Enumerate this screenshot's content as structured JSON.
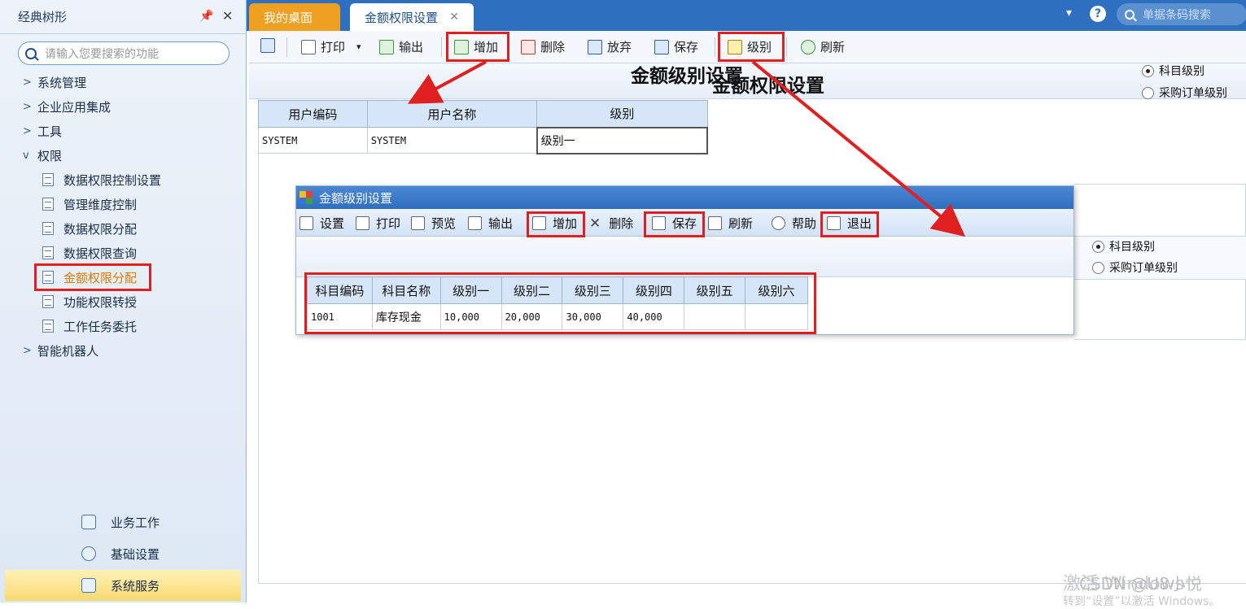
{
  "sidebar": {
    "title": "经典树形",
    "search_placeholder": "请输入您要搜索的功能",
    "tree": [
      {
        "label": "系统管理"
      },
      {
        "label": "企业应用集成"
      },
      {
        "label": "工具"
      },
      {
        "label": "权限"
      }
    ],
    "leaves": [
      {
        "label": "数据权限控制设置"
      },
      {
        "label": "管理维度控制"
      },
      {
        "label": "数据权限分配"
      },
      {
        "label": "数据权限查询"
      },
      {
        "label": "金额权限分配"
      },
      {
        "label": "功能权限转授"
      },
      {
        "label": "工作任务委托"
      }
    ],
    "tree_after": "智能机器人",
    "bottom": [
      {
        "label": "业务工作"
      },
      {
        "label": "基础设置"
      },
      {
        "label": "系统服务"
      }
    ]
  },
  "tabs": [
    {
      "label": "我的桌面"
    },
    {
      "label": "金额权限设置"
    }
  ],
  "top_search_placeholder": "单据条码搜索",
  "toolbar": {
    "print": "打印",
    "export": "输出",
    "add": "增加",
    "delete": "删除",
    "discard": "放弃",
    "save": "保存",
    "level": "级别",
    "refresh": "刷新"
  },
  "page_title": "金额权限设置",
  "radios": {
    "subject": "科目级别",
    "purchase": "采购订单级别"
  },
  "user_table": {
    "headers": [
      "用户编码",
      "用户名称",
      "级别"
    ],
    "rows": [
      [
        "SYSTEM",
        "SYSTEM",
        "级别一"
      ]
    ]
  },
  "dialog": {
    "title": "金额级别设置",
    "toolbar": {
      "settings": "设置",
      "print": "打印",
      "preview": "预览",
      "export": "输出",
      "add": "增加",
      "delete": "删除",
      "save": "保存",
      "refresh": "刷新",
      "help": "帮助",
      "exit": "退出"
    },
    "heading": "金额级别设置",
    "headers": [
      "科目编码",
      "科目名称",
      "级别一",
      "级别二",
      "级别三",
      "级别四",
      "级别五",
      "级别六"
    ],
    "rows": [
      [
        "1001",
        "库存现金",
        "10,000",
        "20,000",
        "30,000",
        "40,000",
        "",
        ""
      ]
    ]
  },
  "watermark": {
    "line1": "激活 Windows",
    "line2": "转到“设置”以激活 Windows。",
    "credit": "CSDN @U8小悦"
  },
  "colors": {
    "accent": "#2f6fc0",
    "highlight": "#e02020",
    "tab_active_orange": "#f0a020"
  }
}
